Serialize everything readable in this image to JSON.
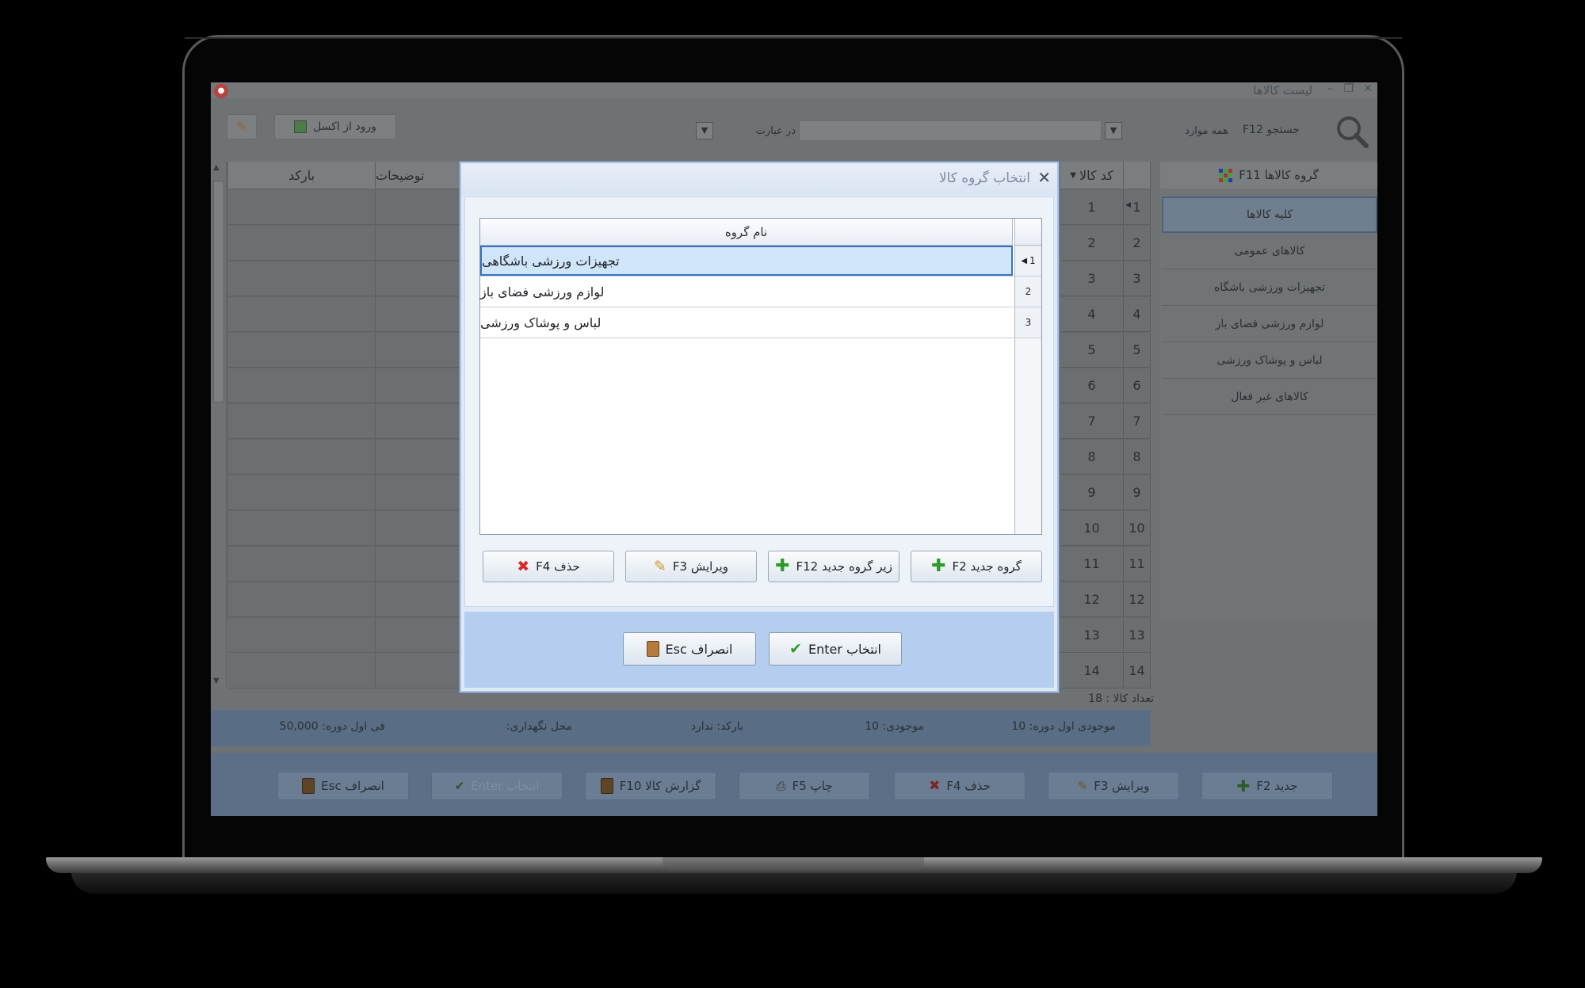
{
  "window": {
    "title": "لیست کالاها",
    "minimize": "–",
    "maximize": "❐",
    "close": "✕"
  },
  "toolbar": {
    "search_label": "جستجو F12",
    "search_scope_value": "همه موارد",
    "search_text_value": "",
    "search_mode_value": "در عبارت",
    "excel_import_label": "ورود از اکسل"
  },
  "side_panel": {
    "header": "گروه کالاها F11",
    "items": [
      "کلیه کالاها",
      "کالاهای عمومی",
      "تجهیزات ورزشی باشگاه",
      "لوازم ورزشی فضای باز",
      "لباس و پوشاک ورزشی",
      "کالاهای غیر فعال"
    ]
  },
  "grid": {
    "columns": {
      "code": "کد کالا",
      "description": "توضیحات",
      "barcode": "بارکد"
    },
    "row_numbers": [
      "1",
      "2",
      "3",
      "4",
      "5",
      "6",
      "7",
      "8",
      "9",
      "10",
      "11",
      "12",
      "13",
      "14"
    ],
    "item_codes": [
      "1",
      "2",
      "3",
      "4",
      "5",
      "6",
      "7",
      "8",
      "9",
      "10",
      "11",
      "12",
      "13",
      "14"
    ],
    "count_label": "تعداد کالا : 18"
  },
  "status": {
    "opening_stock": "موجودی اول دوره: 10",
    "stock": "موجودی: 10",
    "barcode": "بارکد: ندارد",
    "storage": "محل نگهداری:",
    "opening_price": "فی اول دوره: 50,000"
  },
  "bottom_bar": {
    "new": "جدید F2",
    "edit": "ویرایش F3",
    "delete": "حذف F4",
    "print": "چاپ F5",
    "report": "گزارش کالا F10",
    "select": "انتخاب Enter",
    "cancel": "انصراف Esc"
  },
  "dialog": {
    "title": "انتخاب گروه کالا",
    "column_header": "نام گروه",
    "rows": [
      {
        "num": "1",
        "name": "تجهیزات ورزشی باشگاهی"
      },
      {
        "num": "2",
        "name": "لوازم ورزشی فضای باز"
      },
      {
        "num": "3",
        "name": "لباس و پوشاک ورزشی"
      }
    ],
    "buttons": {
      "new_group": "گروه جدید F2",
      "new_subgroup": "زیر گروه جدید F12",
      "edit": "ویرایش F3",
      "delete": "حذف F4"
    },
    "footer": {
      "select": "انتخاب Enter",
      "cancel": "انصراف Esc"
    }
  },
  "colors": {
    "dialog_background": "#dfe8f5",
    "dialog_footer": "#b5cdef",
    "selection_border": "#3a73c2",
    "dimmed_app": "#6e7275"
  }
}
